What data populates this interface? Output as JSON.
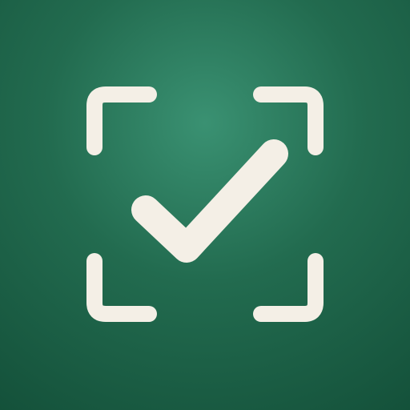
{
  "icon": {
    "name": "scan-check-app-icon",
    "colors": {
      "background_center": "#3a9172",
      "background_mid": "#226b4f",
      "background_edge": "#14513a",
      "glyph": "#f4efe6"
    },
    "symbols": [
      "scan-frame-icon",
      "check-mark-icon"
    ]
  }
}
